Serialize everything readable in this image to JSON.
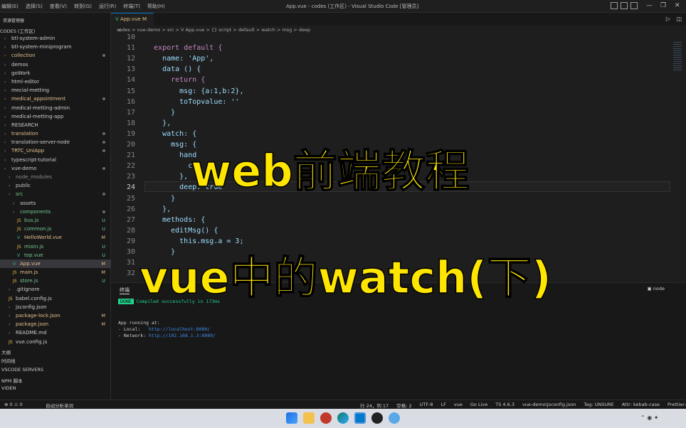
{
  "titlebar": {
    "menu": [
      "编辑(E)",
      "选择(S)",
      "查看(V)",
      "转到(G)",
      "运行(R)",
      "终端(T)",
      "帮助(H)"
    ],
    "window_title": "App.vue - codes (工作区) - Visual Studio Code [管理员]"
  },
  "sidebar": {
    "header": "资源管理器",
    "root_label": "CODES (工作区)",
    "items": [
      {
        "label": "btl-system-admin",
        "color": "#cccccc",
        "status": ""
      },
      {
        "label": "btl-system-miniprogram",
        "color": "#cccccc",
        "status": ""
      },
      {
        "label": "collection",
        "color": "#e2c08d",
        "status": "dot"
      },
      {
        "label": "demos",
        "color": "#cccccc",
        "status": ""
      },
      {
        "label": "goWork",
        "color": "#cccccc",
        "status": ""
      },
      {
        "label": "html-editor",
        "color": "#cccccc",
        "status": ""
      },
      {
        "label": "mecial-metting",
        "color": "#cccccc",
        "status": ""
      },
      {
        "label": "medical_appointment",
        "color": "#e2c08d",
        "status": "dot"
      },
      {
        "label": "medical-metting-admin",
        "color": "#cccccc",
        "status": ""
      },
      {
        "label": "medical-metting-app",
        "color": "#cccccc",
        "status": ""
      },
      {
        "label": "RESEARCH",
        "color": "#cccccc",
        "status": ""
      },
      {
        "label": "translation",
        "color": "#e2c08d",
        "status": "dot"
      },
      {
        "label": "translation-server-node",
        "color": "#cccccc",
        "status": "dot"
      },
      {
        "label": "TRTC_UniApp",
        "color": "#e2c08d",
        "status": "dot"
      },
      {
        "label": "typescript-tutorial",
        "color": "#cccccc",
        "status": ""
      },
      {
        "label": "vue-demo",
        "color": "#cccccc",
        "status": "dot"
      },
      {
        "label": "node_modules",
        "color": "#8c8c8c",
        "status": ""
      },
      {
        "label": "public",
        "color": "#cccccc",
        "status": ""
      },
      {
        "label": "src",
        "color": "#73c991",
        "status": "dot"
      },
      {
        "label": "assets",
        "color": "#cccccc",
        "status": ""
      },
      {
        "label": "components",
        "color": "#73c991",
        "status": "dot"
      },
      {
        "label": "bus.js",
        "color": "#73c991",
        "status": "U"
      },
      {
        "label": "common.js",
        "color": "#73c991",
        "status": "U"
      },
      {
        "label": "HelloWorld.vue",
        "color": "#e2c08d",
        "status": "M"
      },
      {
        "label": "mixin.js",
        "color": "#73c991",
        "status": "U"
      },
      {
        "label": "top.vue",
        "color": "#73c991",
        "status": "U"
      },
      {
        "label": "App.vue",
        "color": "#e2c08d",
        "status": "M"
      },
      {
        "label": "main.js",
        "color": "#e2c08d",
        "status": "M"
      },
      {
        "label": "store.js",
        "color": "#73c991",
        "status": "U"
      },
      {
        "label": ".gitignore",
        "color": "#cccccc",
        "status": ""
      },
      {
        "label": "babel.config.js",
        "color": "#cccccc",
        "status": ""
      },
      {
        "label": "jsconfig.json",
        "color": "#cccccc",
        "status": ""
      },
      {
        "label": "package-lock.json",
        "color": "#e2c08d",
        "status": "M"
      },
      {
        "label": "package.json",
        "color": "#e2c08d",
        "status": "M"
      },
      {
        "label": "README.md",
        "color": "#cccccc",
        "status": ""
      },
      {
        "label": "vue.config.js",
        "color": "#cccccc",
        "status": ""
      }
    ],
    "footer": [
      "大纲",
      "时间线",
      "VSCODE SERVERS",
      "NPM 脚本",
      "VIDEN"
    ]
  },
  "tab": {
    "label": "App.vue M"
  },
  "breadcrumb": "codes > vue-demo > src > V App.vue > {} script > default > watch > msg > deep",
  "editor": {
    "lines": [
      {
        "n": "10",
        "code": ""
      },
      {
        "n": "11",
        "code": "  export default {"
      },
      {
        "n": "12",
        "code": "    name: 'App',"
      },
      {
        "n": "13",
        "code": "    data () {"
      },
      {
        "n": "14",
        "code": "      return {"
      },
      {
        "n": "15",
        "code": "        msg: {a:1,b:2},"
      },
      {
        "n": "16",
        "code": "        toTopvalue: ''"
      },
      {
        "n": "17",
        "code": "      }"
      },
      {
        "n": "18",
        "code": "    },"
      },
      {
        "n": "19",
        "code": "    watch: {"
      },
      {
        "n": "20",
        "code": "      msg: {"
      },
      {
        "n": "21",
        "code": "        hand"
      },
      {
        "n": "22",
        "code": "          con"
      },
      {
        "n": "23",
        "code": "        },"
      },
      {
        "n": "24",
        "code": "        deep: true"
      },
      {
        "n": "25",
        "code": "      }"
      },
      {
        "n": "26",
        "code": "    },"
      },
      {
        "n": "27",
        "code": "    methods: {"
      },
      {
        "n": "28",
        "code": "      editMsg() {"
      },
      {
        "n": "29",
        "code": "        this.msg.a = 3;"
      },
      {
        "n": "30",
        "code": "      }"
      },
      {
        "n": "31",
        "code": ""
      },
      {
        "n": "32",
        "code": ""
      }
    ],
    "current_line": "24"
  },
  "panel": {
    "tab": "终端",
    "shell": "node",
    "done": "DONE",
    "compiled": "Compiled successfully in 173ms",
    "running": "App running at:",
    "local_label": "- Local:   ",
    "local_url": "http://localhost:8080/",
    "network_label": "- Network: ",
    "network_url": "http://192.168.1.3:8080/"
  },
  "statusbar": {
    "left": [
      "⊗ 0  ⚠ 0",
      "自动分析单词"
    ],
    "right": [
      "行 24，列 17",
      "空格: 2",
      "UTF-8",
      "LF",
      "vue",
      "Go Live",
      "TS 4.6.3",
      "vue-demo\\jsconfig.json",
      "Tag: UNSURE",
      "Attr: kebab-case",
      "Prettier✓",
      "Pre"
    ]
  },
  "overlay": {
    "title": "web前端教程",
    "subtitle": "vue中的watch(下)"
  },
  "colors": {
    "keyword": "#c586c0",
    "string": "#ce9178",
    "property": "#9cdcfe",
    "bracket": "#ffd700",
    "overlay": "#ffe600"
  }
}
